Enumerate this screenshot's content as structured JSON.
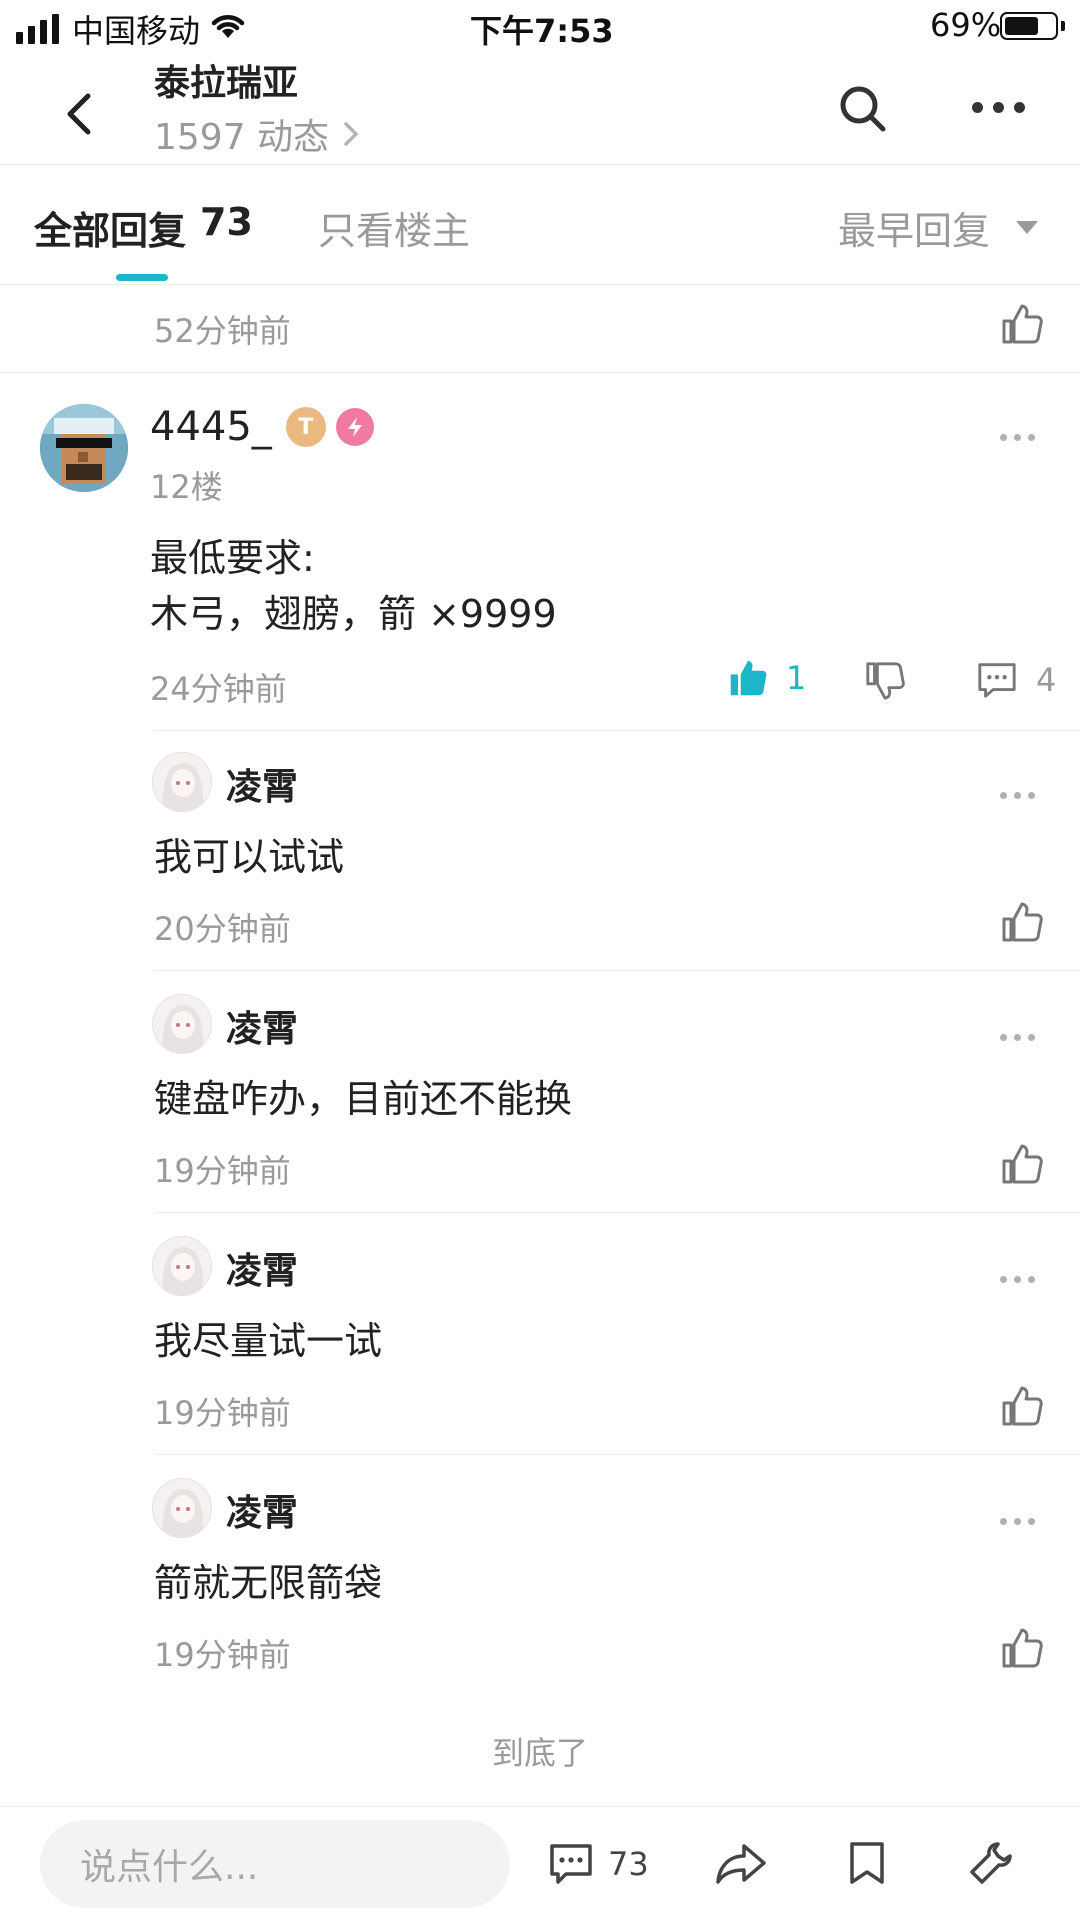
{
  "status": {
    "carrier": "中国移动",
    "time": "下午7:53",
    "battery": "69%",
    "battery_level": 0.69
  },
  "header": {
    "title": "泰拉瑞亚",
    "subtitle": "1597 动态",
    "back_icon": "back-arrow-icon",
    "search_icon": "search-icon",
    "more_icon": "more-icon"
  },
  "tabs": {
    "all_label": "全部回复",
    "all_count": "73",
    "op_label": "只看楼主",
    "sort_label": "最早回复",
    "accent": "#1cb6c8"
  },
  "prev_reply": {
    "time": "52分钟前"
  },
  "post": {
    "username": "4445_",
    "floor": "12楼",
    "lines": [
      "最低要求:",
      "木弓，翅膀，箭 ×9999"
    ],
    "time": "24分钟前",
    "likes": "1",
    "comments": "4"
  },
  "replies": [
    {
      "user": "凌霄",
      "text": "我可以试试",
      "time": "20分钟前"
    },
    {
      "user": "凌霄",
      "text": "键盘咋办，目前还不能换",
      "time": "19分钟前"
    },
    {
      "user": "凌霄",
      "text": "我尽量试一试",
      "time": "19分钟前"
    },
    {
      "user": "凌霄",
      "text": "箭就无限箭袋",
      "time": "19分钟前"
    }
  ],
  "footer_note": "到底了",
  "bottom": {
    "placeholder": "说点什么...",
    "comment_count": "73"
  }
}
